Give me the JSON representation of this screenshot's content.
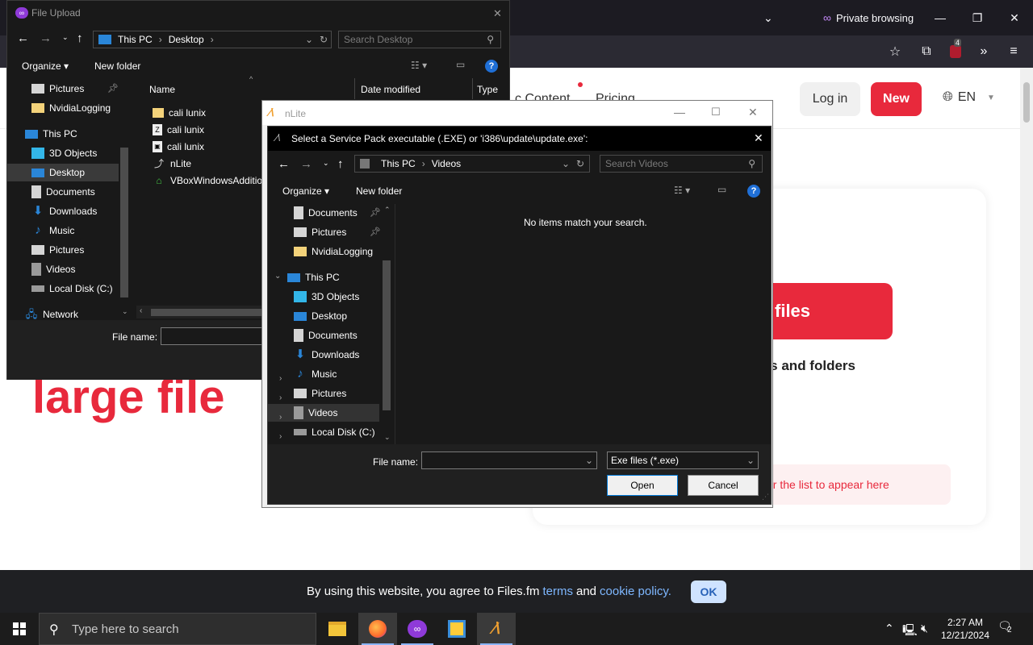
{
  "browser": {
    "private_label": "Private browsing",
    "extension_badge": "4",
    "tab_title": "File Upload"
  },
  "page": {
    "nav": [
      "c Content",
      "Pricing"
    ],
    "login": "Log in",
    "new": "New",
    "language": "EN",
    "hero": "large file",
    "select_files": "files",
    "drop_text": "les and folders",
    "list_note": "or the list to appear here"
  },
  "cookie": {
    "text_before": "By using this website, you agree to Files.fm",
    "terms": "terms",
    "and": "and",
    "policy": "cookie policy.",
    "ok": "OK"
  },
  "taskbar": {
    "search_placeholder": "Type here to search",
    "time": "2:27 AM",
    "date": "12/21/2024",
    "notif_count": "2"
  },
  "file_upload": {
    "title": "File Upload",
    "breadcrumb": [
      "This PC",
      "Desktop"
    ],
    "search_placeholder": "Search Desktop",
    "organize": "Organize",
    "new_folder": "New folder",
    "columns": [
      "Name",
      "Date modified",
      "Type"
    ],
    "nav": [
      {
        "label": "Pictures",
        "icon": "pictures-icon"
      },
      {
        "label": "NvidiaLogging",
        "icon": "folder-icon"
      },
      {
        "label": "This PC",
        "icon": "computer-icon"
      },
      {
        "label": "3D Objects",
        "icon": "3d-objects-icon"
      },
      {
        "label": "Desktop",
        "icon": "desktop-icon"
      },
      {
        "label": "Documents",
        "icon": "documents-icon"
      },
      {
        "label": "Downloads",
        "icon": "downloads-icon"
      },
      {
        "label": "Music",
        "icon": "music-icon"
      },
      {
        "label": "Pictures",
        "icon": "pictures-icon"
      },
      {
        "label": "Videos",
        "icon": "videos-icon"
      },
      {
        "label": "Local Disk (C:)",
        "icon": "drive-icon"
      },
      {
        "label": "Network",
        "icon": "network-icon"
      }
    ],
    "files": [
      {
        "name": "cali lunix",
        "icon": "folder-icon"
      },
      {
        "name": "cali lunix",
        "icon": "file-icon"
      },
      {
        "name": "cali lunix",
        "icon": "disc-image-icon"
      },
      {
        "name": "nLite",
        "icon": "shortcut-icon"
      },
      {
        "name": "VBoxWindowsAddition",
        "icon": "application-icon"
      }
    ],
    "file_name_label": "File name:"
  },
  "nlite": {
    "title": "nLite",
    "inner_title": "Select a Service Pack executable (.EXE) or 'i386\\update\\update.exe':",
    "breadcrumb": [
      "This PC",
      "Videos"
    ],
    "search_placeholder": "Search Videos",
    "organize": "Organize",
    "new_folder": "New folder",
    "empty_message": "No items match your search.",
    "nav": [
      {
        "label": "Documents",
        "icon": "documents-icon"
      },
      {
        "label": "Pictures",
        "icon": "pictures-icon"
      },
      {
        "label": "NvidiaLogging",
        "icon": "folder-icon"
      },
      {
        "label": "This PC",
        "icon": "computer-icon"
      },
      {
        "label": "3D Objects",
        "icon": "3d-objects-icon"
      },
      {
        "label": "Desktop",
        "icon": "desktop-icon"
      },
      {
        "label": "Documents",
        "icon": "documents-icon"
      },
      {
        "label": "Downloads",
        "icon": "downloads-icon"
      },
      {
        "label": "Music",
        "icon": "music-icon"
      },
      {
        "label": "Pictures",
        "icon": "pictures-icon"
      },
      {
        "label": "Videos",
        "icon": "videos-icon"
      },
      {
        "label": "Local Disk (C:)",
        "icon": "drive-icon"
      }
    ],
    "file_name_label": "File name:",
    "file_type": "Exe files (*.exe)",
    "open": "Open",
    "cancel": "Cancel"
  }
}
